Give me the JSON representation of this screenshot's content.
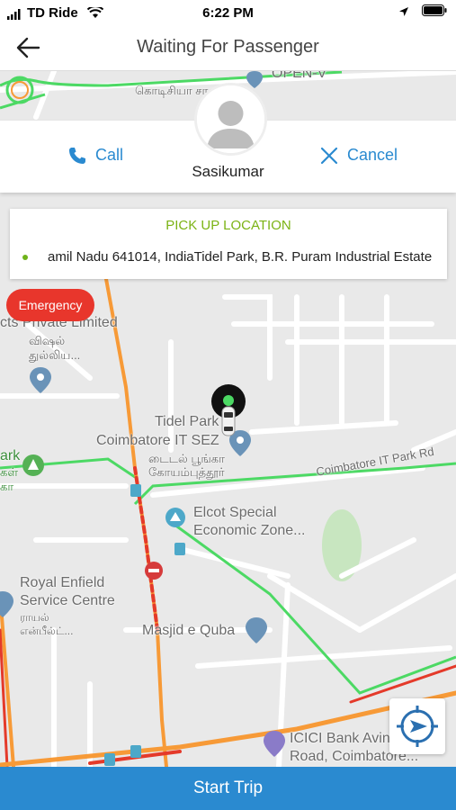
{
  "status_bar": {
    "carrier": "TD Ride",
    "time": "6:22 PM"
  },
  "nav": {
    "title": "Waiting For Passenger"
  },
  "actions": {
    "call_label": "Call",
    "cancel_label": "Cancel"
  },
  "passenger": {
    "name": "Sasikumar"
  },
  "pickup": {
    "title": "PICK UP LOCATION",
    "address": "amil Nadu 641014, IndiaTidel Park, B.R. Puram Industrial Estate"
  },
  "emergency_label": "Emergency",
  "map": {
    "labels": {
      "open_v": "OPEN-V",
      "kodisiya": "கொடிசியா சாலை",
      "contracts": "cts Private Limited",
      "vishal": "விஷல்",
      "thulliya": "துல்லிய...",
      "tidel_park": "Tidel Park",
      "coimbatore_it_sez": "Coimbatore IT SEZ",
      "tidel_tamil": "டைடல் பூங்கா",
      "coimbatore_tamil": "கோயம்புத்தூர்",
      "park": "ark",
      "park_tamil_1": "கள்",
      "park_tamil_2": "கா",
      "it_park_rd": "Coimbatore IT Park Rd",
      "elcot": "Elcot Special",
      "economic_zone": "Economic Zone...",
      "royal_enfield": "Royal Enfield",
      "service_centre": "Service Centre",
      "royal_tamil_1": "ராயல்",
      "royal_tamil_2": "என்பீல்ட்...",
      "masjid": "Masjid e Quba",
      "icici": "ICICI Bank Avin",
      "icici_road": "Road, Coimbatore..."
    }
  },
  "start_trip_label": "Start Trip",
  "colors": {
    "accent": "#2a8ad0",
    "pickup_title": "#7bb314",
    "emergency": "#e8362c"
  }
}
